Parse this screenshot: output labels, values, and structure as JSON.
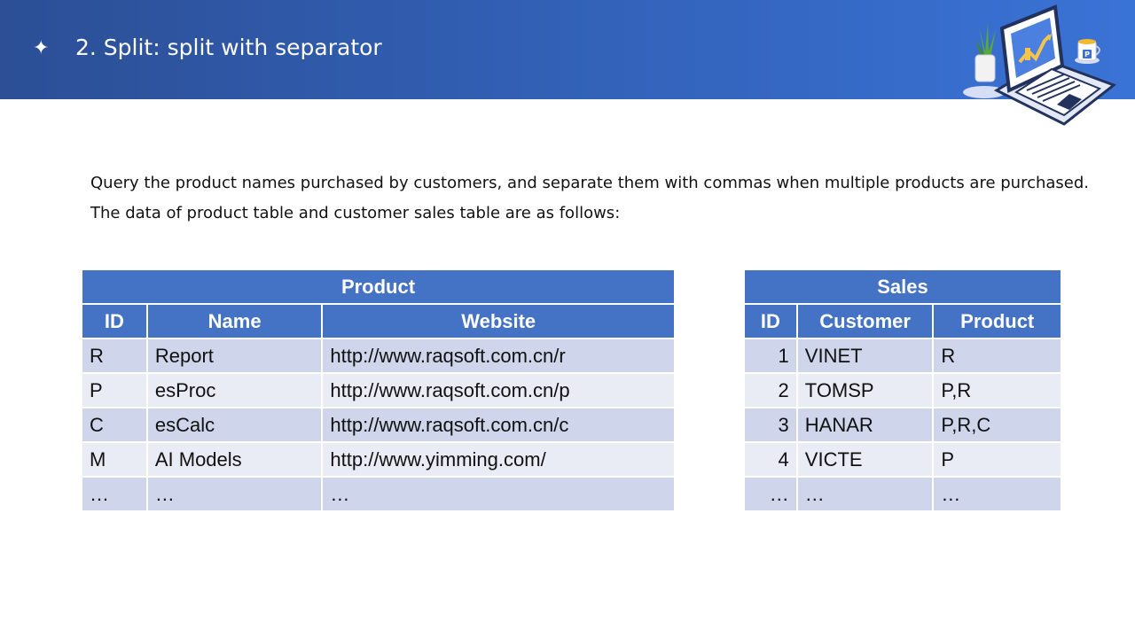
{
  "slide": {
    "bullet_icon": "four-point-star",
    "title": "2. Split: split with separator"
  },
  "description": {
    "line1": "Query the product names purchased by customers, and separate them with commas when multiple products are purchased.",
    "line2": "The data of product table and customer sales table are as follows:"
  },
  "product_table": {
    "caption": "Product",
    "headers": [
      "ID",
      "Name",
      "Website"
    ],
    "rows": [
      [
        "R",
        "Report",
        "http://www.raqsoft.com.cn/r"
      ],
      [
        "P",
        "esProc",
        "http://www.raqsoft.com.cn/p"
      ],
      [
        "C",
        "esCalc",
        "http://www.raqsoft.com.cn/c"
      ],
      [
        "M",
        "AI Models",
        "http://www.yimming.com/"
      ],
      [
        "…",
        "…",
        "…"
      ]
    ]
  },
  "sales_table": {
    "caption": "Sales",
    "headers": [
      "ID",
      "Customer",
      "Product"
    ],
    "rows": [
      [
        "1",
        "VINET",
        "R"
      ],
      [
        "2",
        "TOMSP",
        "P,R"
      ],
      [
        "3",
        "HANAR",
        "P,R,C"
      ],
      [
        "4",
        "VICTE",
        "P"
      ],
      [
        "…",
        "…",
        "…"
      ]
    ]
  },
  "colors": {
    "header_bar": "#3568c4",
    "table_header": "#4472c4",
    "row_odd": "#cfd5ea",
    "row_even": "#e9ebf5"
  },
  "illustration": {
    "icons": [
      "laptop-icon",
      "potted-plant-icon",
      "coffee-mug-icon"
    ],
    "mug_label": "P"
  }
}
